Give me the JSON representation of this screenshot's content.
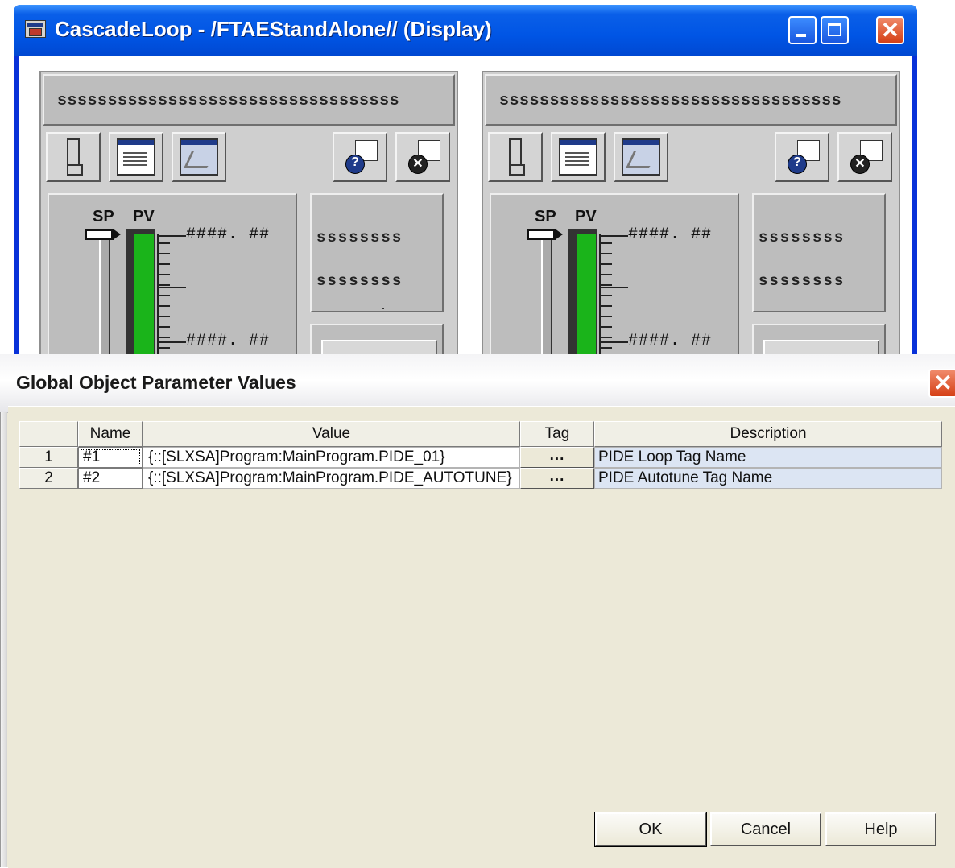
{
  "back_window": {
    "title": "CascadeLoop - /FTAEStandAlone// (Display)",
    "faceplates": [
      {
        "tag_label": "ssssssssssssssssssssssssssssssssss",
        "sp_label": "SP",
        "pv_label": "PV",
        "pv_high": "####. ##",
        "pv_low": "####. ##",
        "side_text_1": "ssssssss",
        "side_text_2": "ssssssss"
      },
      {
        "tag_label": "ssssssssssssssssssssssssssssssssss",
        "sp_label": "SP",
        "pv_label": "PV",
        "pv_high": "####. ##",
        "pv_low": "####. ##",
        "side_text_1": "ssssssss",
        "side_text_2": "ssssssss"
      }
    ],
    "icons": [
      "app-icon",
      "minimize-icon",
      "maximize-icon",
      "close-icon",
      "faceplate-icon",
      "form-icon",
      "trend-icon",
      "help-icon",
      "close-faceplate-icon"
    ]
  },
  "dialog": {
    "title": "Global Object Parameter Values",
    "columns": [
      "",
      "Name",
      "Value",
      "Tag",
      "Description"
    ],
    "rows": [
      {
        "index": "1",
        "name": "#1",
        "value": "{::[SLXSA]Program:MainProgram.PIDE_01}",
        "tag": "...",
        "description": "PIDE Loop Tag Name"
      },
      {
        "index": "2",
        "name": "#2",
        "value": "{::[SLXSA]Program:MainProgram.PIDE_AUTOTUNE}",
        "tag": "...",
        "description": "PIDE Autotune Tag Name"
      }
    ],
    "buttons": {
      "ok": "OK",
      "cancel": "Cancel",
      "help": "Help"
    }
  },
  "colors": {
    "xp_title_blue": "#0055e5",
    "pv_bar_green": "#1ab41a",
    "dialog_bg": "#ece9d8",
    "description_cell": "#dce5f3"
  }
}
